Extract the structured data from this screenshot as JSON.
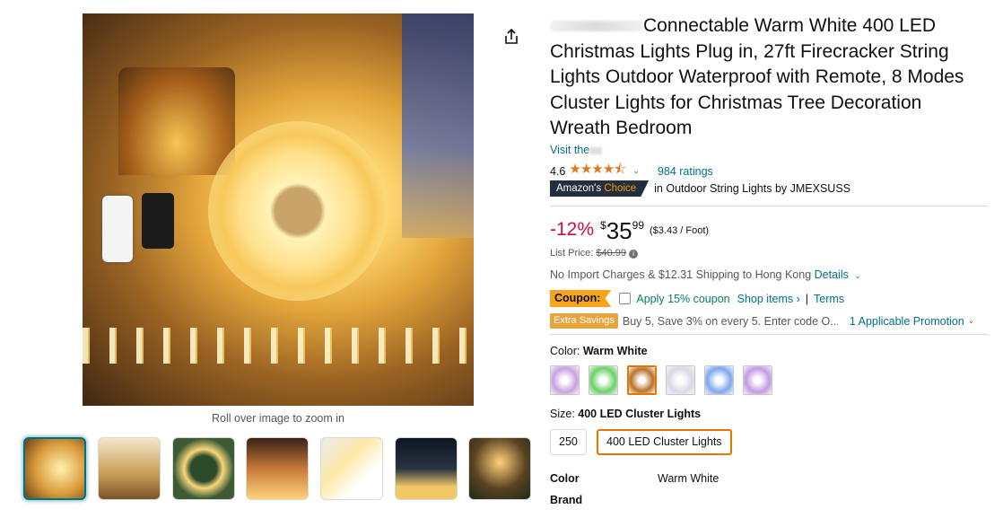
{
  "product": {
    "title_text": "Connectable Warm White 400 LED Christmas Lights Plug in, 27ft Firecracker String Lights Outdoor Waterproof with Remote, 8 Modes Cluster Lights for Christmas Tree Decoration Wreath Bedroom",
    "store_link": "Visit the",
    "rating": "4.6",
    "stars": "★★★★⯪",
    "ratings_count": "984 ratings",
    "badge_prefix": "Amazon's",
    "badge_choice": "Choice",
    "choice_text": "in Outdoor String Lights by JMEXSUSS"
  },
  "gallery": {
    "zoom_caption": "Roll over image to zoom in",
    "thumbnail_count": 7
  },
  "price": {
    "discount": "-12%",
    "currency": "$",
    "whole": "35",
    "fraction": "99",
    "unit_price": "($3.43 / Foot)",
    "list_price_label": "List Price:",
    "list_price": "$40.99"
  },
  "shipping": {
    "text": "No Import Charges & $12.31 Shipping to Hong Kong",
    "details_link": "Details"
  },
  "coupon": {
    "tag": "Coupon:",
    "apply_text": "Apply 15% coupon",
    "shop_link": "Shop items ›",
    "separator": "|",
    "terms_link": "Terms"
  },
  "promo": {
    "tag": "Extra Savings",
    "text": "Buy 5, Save 3% on every 5. Enter code O...",
    "link": "1 Applicable Promotion"
  },
  "color": {
    "label": "Color:",
    "value": "Warm White",
    "swatches": [
      "#c9a3e0",
      "#6ed26a",
      "#b8732a",
      "#d9d9e6",
      "#7fa8ef",
      "#c49be3"
    ],
    "selected_index": 2
  },
  "size": {
    "label": "Size:",
    "value": "400 LED Cluster Lights",
    "options": [
      "250",
      "400 LED Cluster Lights"
    ]
  },
  "specs": {
    "color_key": "Color",
    "color_val": "Warm White",
    "brand_key": "Brand"
  },
  "colors": {
    "link": "#007185",
    "deal": "#cc0c39",
    "star": "#de7921",
    "selected": "#e77600"
  }
}
